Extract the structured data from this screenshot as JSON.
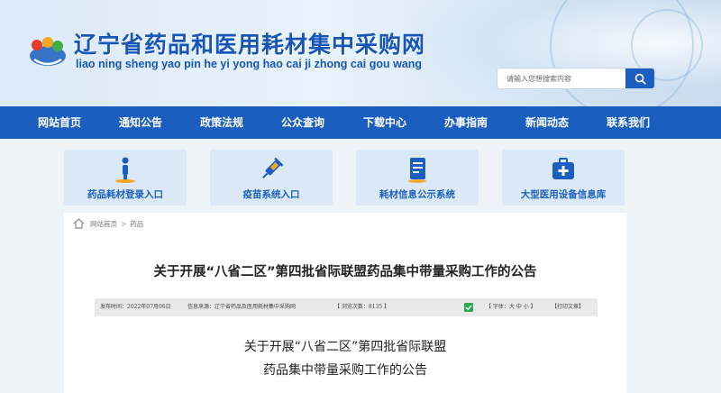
{
  "header": {
    "title": "辽宁省药品和医用耗材集中采购网",
    "pinyin": "liao ning sheng yao pin he yi yong hao cai ji zhong cai gou wang"
  },
  "search": {
    "placeholder": "请输入您想搜索内容"
  },
  "nav": {
    "items": [
      {
        "label": "网站首页"
      },
      {
        "label": "通知公告"
      },
      {
        "label": "政策法规"
      },
      {
        "label": "公众查询"
      },
      {
        "label": "下载中心"
      },
      {
        "label": "办事指南"
      },
      {
        "label": "新闻动态"
      },
      {
        "label": "联系我们"
      }
    ]
  },
  "entries": [
    {
      "label": "药品耗材登录入口",
      "icon": "person-icon"
    },
    {
      "label": "疫苗系统入口",
      "icon": "syringe-icon"
    },
    {
      "label": "耗材信息公示系统",
      "icon": "document-icon"
    },
    {
      "label": "大型医用设备信息库",
      "icon": "medical-kit-icon"
    }
  ],
  "breadcrumb": {
    "home": "网站首页",
    "current": "药品"
  },
  "article": {
    "title": "关于开展“八省二区”第四批省际联盟药品集中带量采购工作的公告",
    "meta": {
      "date": "发布时间：2022年07月06日",
      "source": "信息来源：辽宁省药品及医用耗材集中采购网",
      "views": "【 浏览次数：8135 】",
      "font": "【 字体：大  中  小 】",
      "print": "【打印文章】"
    },
    "body_title_line1": "关于开展“八省二区”第四批省际联盟",
    "body_title_line2": "药品集中带量采购工作的公告"
  },
  "colors": {
    "primary": "#1a5fc0",
    "entry_bg": "#dbe9f7",
    "page_bg": "#eef3f8"
  }
}
